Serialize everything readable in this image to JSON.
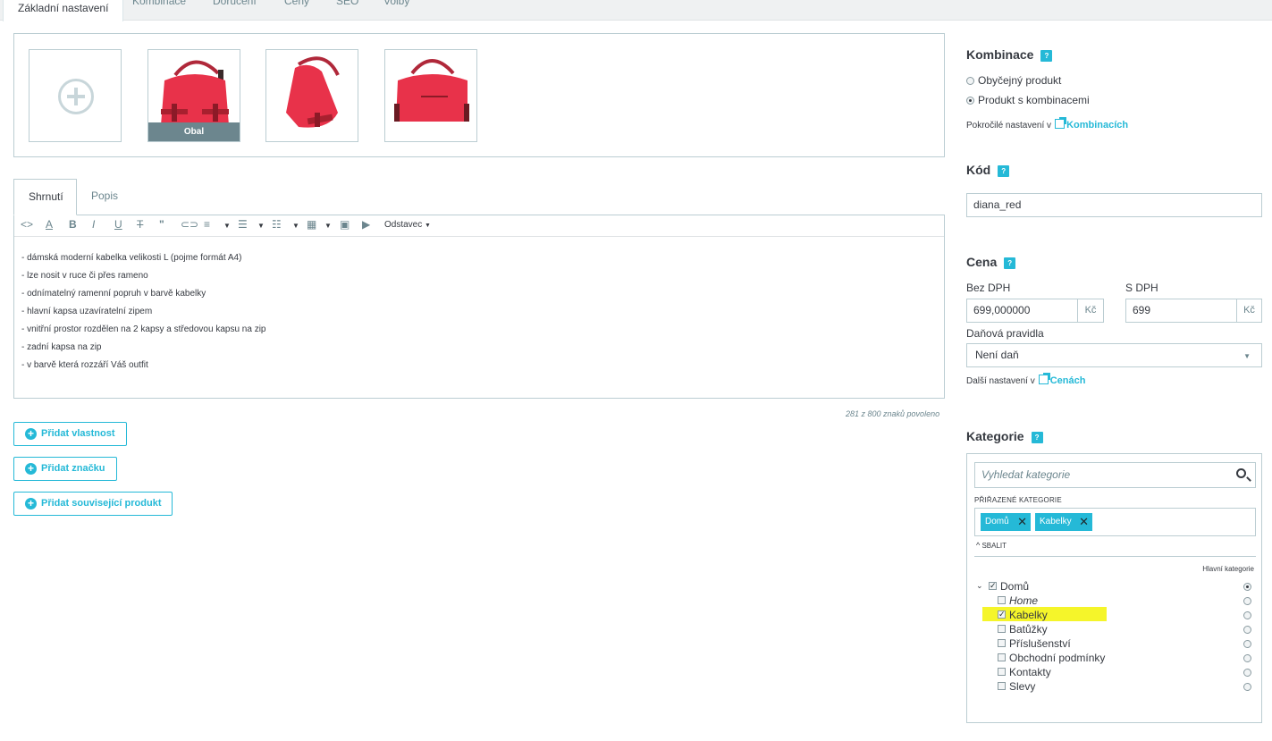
{
  "top_tabs": [
    {
      "label": "Základní nastavení"
    },
    {
      "label": "Kombinace"
    },
    {
      "label": "Doručení"
    },
    {
      "label": "Ceny"
    },
    {
      "label": "SEO"
    },
    {
      "label": "Volby"
    }
  ],
  "images": {
    "cover_label": "Obal"
  },
  "editor_tabs": [
    {
      "label": "Shrnutí"
    },
    {
      "label": "Popis"
    }
  ],
  "toolbar": {
    "paragraph_label": "Odstavec"
  },
  "summary_lines": [
    "- dámská moderní kabelka velikosti L (pojme formát A4)",
    "- lze nosit v ruce či přes rameno",
    "- odnímatelný ramenní popruh v barvě kabelky",
    "- hlavní kapsa uzavíratelní zipem",
    "- vnitřní prostor rozdělen na 2 kapsy a středovou kapsu na zip",
    "- zadní kapsa na zip",
    "- v barvě která rozzáří Váš outfit"
  ],
  "char_count": "281 z 800 znaků povoleno",
  "buttons": {
    "add_feature": "Přidat vlastnost",
    "add_brand": "Přidat značku",
    "add_related": "Přidat související produkt"
  },
  "combinations": {
    "title": "Kombinace",
    "option_simple": "Obyčejný produkt",
    "option_combinations": "Produkt s kombinacemi",
    "advanced_prefix": "Pokročilé nastavení v",
    "advanced_link": "Kombinacích"
  },
  "code": {
    "title": "Kód",
    "value": "diana_red"
  },
  "price": {
    "title": "Cena",
    "without_vat_label": "Bez DPH",
    "with_vat_label": "S DPH",
    "without_vat_value": "699,000000",
    "with_vat_value": "699",
    "currency": "Kč",
    "tax_rules_label": "Daňová pravidla",
    "tax_rule_value": "Není daň",
    "more_prefix": "Další nastavení v",
    "more_link": "Cenách"
  },
  "categories": {
    "title": "Kategorie",
    "search_placeholder": "Vyhledat kategorie",
    "assigned_label": "PŘIŘAZENÉ KATEGORIE",
    "tags": [
      "Domů",
      "Kabelky"
    ],
    "collapse_label": "SBALIT",
    "main_category_label": "Hlavní kategorie",
    "tree": [
      {
        "label": "Domů",
        "checked": true,
        "main": true
      },
      {
        "label": "Home",
        "checked": false,
        "main": false
      },
      {
        "label": "Kabelky",
        "checked": true,
        "main": false
      },
      {
        "label": "Batůžky",
        "checked": false,
        "main": false
      },
      {
        "label": "Příslušenství",
        "checked": false,
        "main": false
      },
      {
        "label": "Obchodní podmínky",
        "checked": false,
        "main": false
      },
      {
        "label": "Kontakty",
        "checked": false,
        "main": false
      },
      {
        "label": "Slevy",
        "checked": false,
        "main": false
      }
    ]
  },
  "colors": {
    "accent": "#25b9d7",
    "highlight": "#f5f52a",
    "bag_red": "#e8324a"
  }
}
